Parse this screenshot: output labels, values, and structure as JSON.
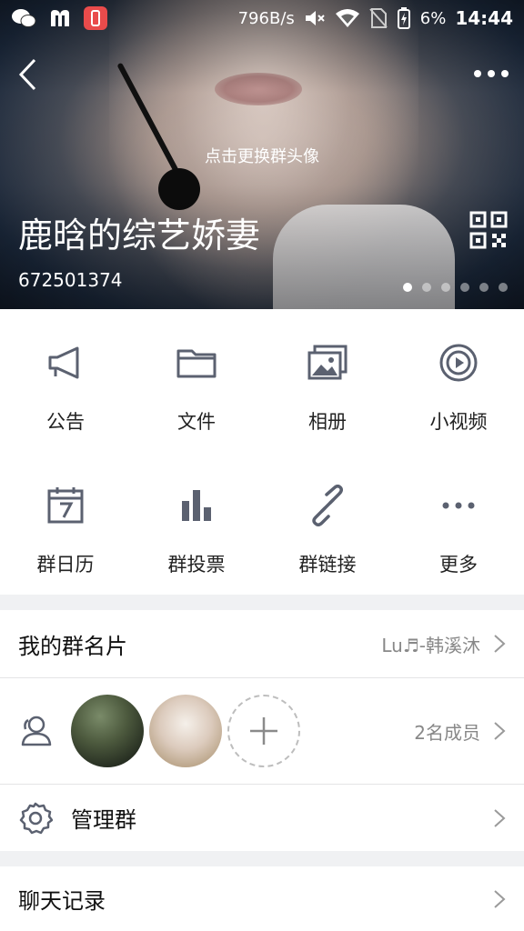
{
  "status_bar": {
    "net_speed": "796B/s",
    "battery": "6%",
    "time": "14:44"
  },
  "header": {
    "change_avatar_hint": "点击更换群头像",
    "group_name": "鹿晗的综艺娇妻",
    "group_id": "672501374",
    "page_indicator": {
      "count": 6,
      "active_index": 0
    }
  },
  "features": [
    {
      "label": "公告",
      "icon": "megaphone-icon"
    },
    {
      "label": "文件",
      "icon": "folder-icon"
    },
    {
      "label": "相册",
      "icon": "photo-album-icon"
    },
    {
      "label": "小视频",
      "icon": "short-video-icon"
    },
    {
      "label": "群日历",
      "icon": "calendar-icon"
    },
    {
      "label": "群投票",
      "icon": "vote-bar-chart-icon"
    },
    {
      "label": "群链接",
      "icon": "link-icon"
    },
    {
      "label": "更多",
      "icon": "more-dots-icon"
    }
  ],
  "my_card": {
    "title": "我的群名片",
    "value": "Lu♬-韩溪沐"
  },
  "members": {
    "count_text": "2名成员"
  },
  "manage": {
    "title": "管理群"
  },
  "chat_history": {
    "title": "聊天记录"
  },
  "colors": {
    "icon_gray": "#5b6170",
    "text_secondary": "#888888",
    "background": "#f0f1f3"
  }
}
